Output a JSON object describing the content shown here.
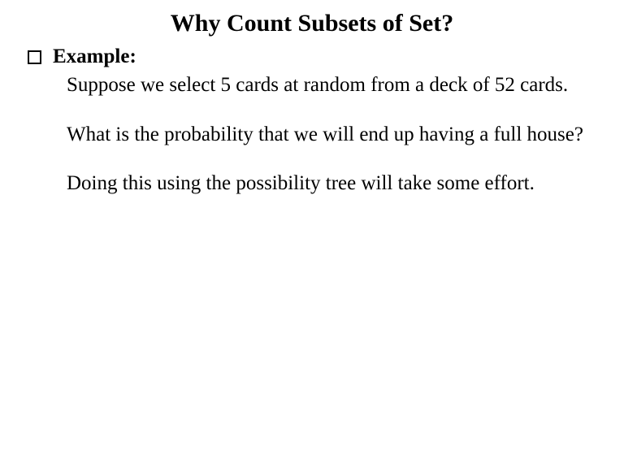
{
  "title": "Why Count Subsets of Set?",
  "bullet": {
    "label": "Example:"
  },
  "paragraphs": {
    "p1": "Suppose we select 5 cards at random from a deck of 52 cards.",
    "p2": "What is the probability that we will end up having a full house?",
    "p3": "Doing this using the possibility tree will take some effort."
  }
}
